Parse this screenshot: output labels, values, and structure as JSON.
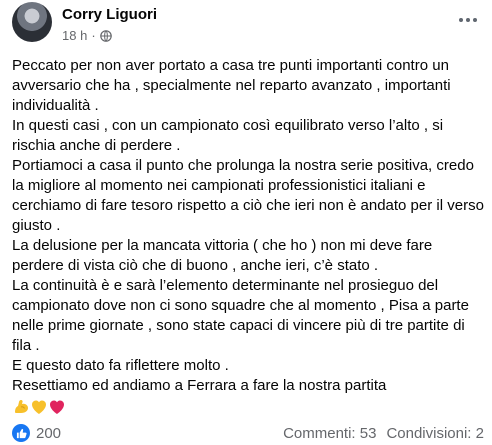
{
  "post": {
    "author": "Corry Liguori",
    "time": "18 h",
    "separator": "·",
    "paragraphs": [
      "Peccato per non aver portato a casa tre punti importanti contro un avversario che ha , specialmente nel reparto avanzato , importanti individualità .",
      "In questi casi , con un campionato così equilibrato verso l’alto , si rischia anche di perdere .",
      "Portiamoci a casa il punto che prolunga la nostra serie positiva, credo la migliore al momento nei campionati professionistici italiani e cerchiamo di fare tesoro rispetto a ciò che ieri non è andato per il verso giusto .",
      "La delusione per la mancata vittoria ( che ho ) non mi deve fare perdere di vista  ciò che di buono , anche ieri,  c’è stato .",
      "La continuità è e sarà l’elemento determinante nel prosieguo del campionato dove non ci sono squadre che al momento , Pisa a parte nelle prime giornate , sono state capaci di vincere più di tre partite di fila .",
      "E questo dato fa riflettere molto .",
      "Resettiamo ed andiamo a Ferrara a fare la nostra partita"
    ]
  },
  "footer": {
    "reaction_count": "200",
    "comments": "Commenti: 53",
    "shares": "Condivisioni: 2"
  },
  "icons": {
    "privacy": "globe-icon",
    "menu": "more-options-icon",
    "reaction": "like-reaction-icon",
    "emojis": [
      "flexed-biceps-emoji",
      "yellow-heart-emoji",
      "red-heart-emoji"
    ]
  },
  "colors": {
    "text": "#050505",
    "secondary": "#65676b",
    "like_blue": "#1877f2",
    "heart_red": "#e0245e",
    "heart_yellow": "#f7c02b"
  }
}
